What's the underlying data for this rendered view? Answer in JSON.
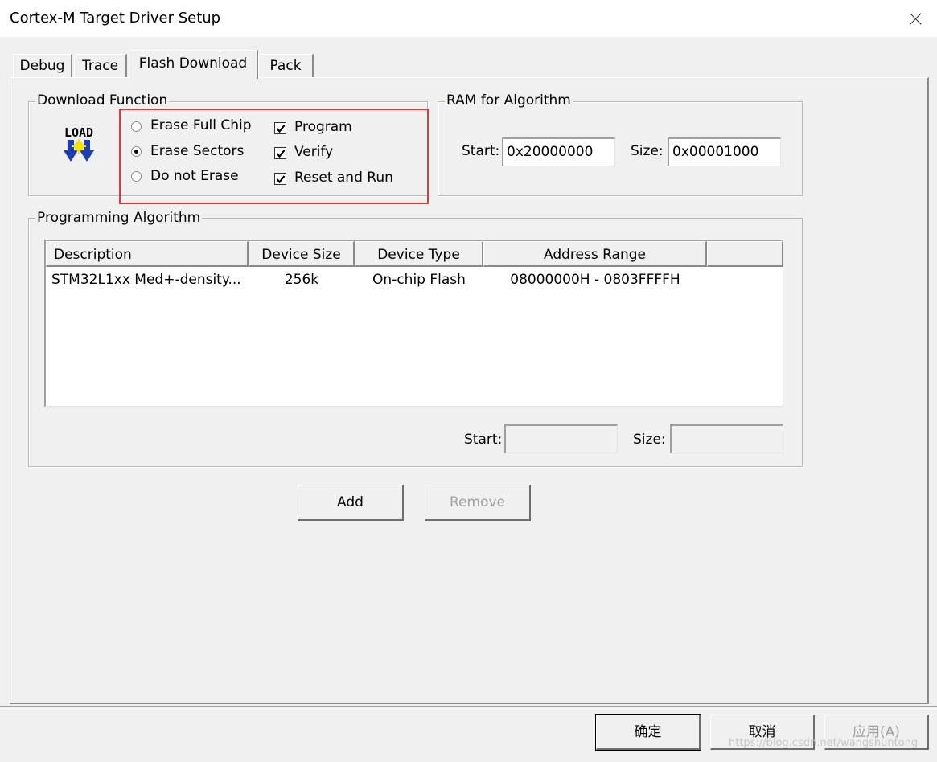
{
  "window": {
    "title": "Cortex-M Target Driver Setup",
    "close_glyph": "close-icon"
  },
  "tabs": [
    {
      "label": "Debug",
      "active": false
    },
    {
      "label": "Trace",
      "active": false
    },
    {
      "label": "Flash Download",
      "active": true
    },
    {
      "label": "Pack",
      "active": false
    }
  ],
  "download_function": {
    "title": "Download Function",
    "icon_text": "LOAD",
    "erase_options": [
      {
        "label": "Erase Full Chip",
        "selected": false
      },
      {
        "label": "Erase Sectors",
        "selected": true
      },
      {
        "label": "Do not Erase",
        "selected": false
      }
    ],
    "checks": [
      {
        "label": "Program",
        "checked": true
      },
      {
        "label": "Verify",
        "checked": true
      },
      {
        "label": "Reset and Run",
        "checked": true
      }
    ]
  },
  "ram_for_algorithm": {
    "title": "RAM for Algorithm",
    "start_label": "Start:",
    "start_value": "0x20000000",
    "size_label": "Size:",
    "size_value": "0x00001000"
  },
  "programming_algorithm": {
    "title": "Programming Algorithm",
    "columns": [
      "Description",
      "Device Size",
      "Device Type",
      "Address Range"
    ],
    "rows": [
      [
        "STM32L1xx Med+-density...",
        "256k",
        "On-chip Flash",
        "08000000H - 0803FFFFH"
      ]
    ],
    "start_label": "Start:",
    "start_value": "",
    "size_label": "Size:",
    "size_value": ""
  },
  "actions": {
    "add": "Add",
    "remove": "Remove"
  },
  "footer": {
    "ok": "确定",
    "cancel": "取消",
    "apply": "应用(A)"
  },
  "watermark": "https://blog.csdn.net/wangshuntong",
  "colors": {
    "highlight": "#e53939",
    "icon_blue": "#1c3cb8",
    "icon_yellow": "#f5e400"
  }
}
